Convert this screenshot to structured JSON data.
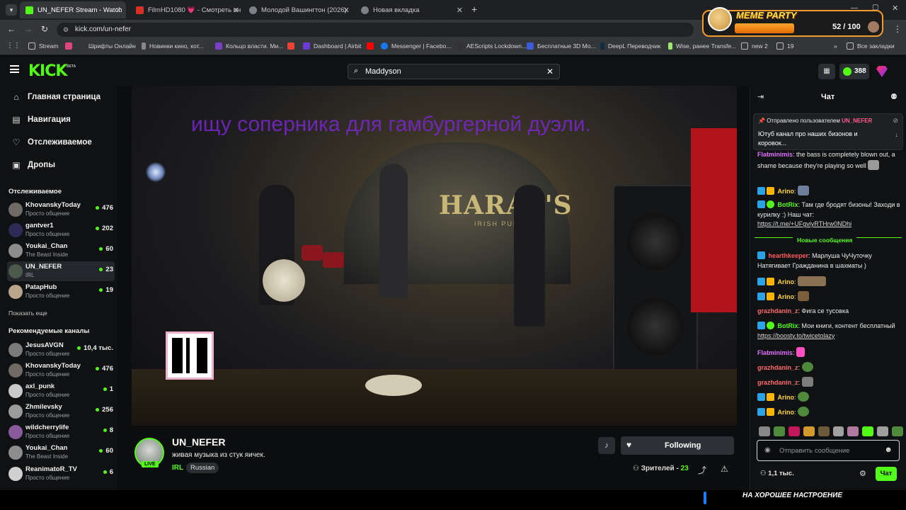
{
  "browser": {
    "tabs": [
      {
        "title": "UN_NEFER Stream - Watch",
        "active": true,
        "color": "#53fc18"
      },
      {
        "title": "FilmHD1080 💗 - Смотреть он",
        "active": false,
        "color": "#d93025"
      },
      {
        "title": "Молодой Вашингтон (2026)",
        "active": false,
        "color": "#9aa0a6"
      },
      {
        "title": "Новая вкладка",
        "active": false,
        "color": "#9aa0a6"
      }
    ],
    "url": "kick.com/un-nefer",
    "bookmarks": [
      "Stream",
      "Шрифты Онлайн",
      "Новинки кино, кот...",
      "Кольцо власти. Ми...",
      "Dashboard | Airbit",
      "Messenger | Facebo...",
      "AEScripts Lockdown...",
      "Бесплатные 3D Мо...",
      "DeepL Переводчик",
      "Wise, ранее Transfe...",
      "new 2",
      "19"
    ],
    "all_bookmarks": "Все закладки"
  },
  "extension": {
    "title": "MEME PARTY",
    "counter": "52 / 100"
  },
  "header": {
    "logo": "KICK",
    "beta": "BETA",
    "search_value": "Maddyson",
    "kicks_count": "388"
  },
  "nav": {
    "home": "Главная страница",
    "browse": "Навигация",
    "following": "Отслеживаемое",
    "drops": "Дропы"
  },
  "following_section": {
    "title": "Отслеживаемое",
    "channels": [
      {
        "name": "KhovanskyToday",
        "category": "Просто общение",
        "viewers": "476"
      },
      {
        "name": "gantver1",
        "category": "Просто общение",
        "viewers": "202"
      },
      {
        "name": "Youkai_Chan",
        "category": "The Beast Inside",
        "viewers": "60"
      },
      {
        "name": "UN_NEFER",
        "category": "IRL",
        "viewers": "23"
      },
      {
        "name": "PatapHub",
        "category": "Просто общение",
        "viewers": "19"
      }
    ],
    "show_more": "Показать еще"
  },
  "recommended_section": {
    "title": "Рекомендуемые каналы",
    "channels": [
      {
        "name": "JesusAVGN",
        "category": "Просто общение",
        "viewers": "10,4 тыс."
      },
      {
        "name": "KhovanskyToday",
        "category": "Просто общение",
        "viewers": "476"
      },
      {
        "name": "axl_punk",
        "category": "Просто общение",
        "viewers": "1"
      },
      {
        "name": "Zhmilevsky",
        "category": "Просто общение",
        "viewers": "256"
      },
      {
        "name": "wildcherrylife",
        "category": "Просто общение",
        "viewers": "8"
      },
      {
        "name": "Youkai_Chan",
        "category": "The Beast Inside",
        "viewers": "60"
      },
      {
        "name": "ReanimatoR_TV",
        "category": "Просто общение",
        "viewers": "6"
      }
    ]
  },
  "video": {
    "overlay_text": "ищу соперника для гамбургерной дуэли.",
    "sign": "HARAT'S",
    "sign_sub": "IRISH PUB"
  },
  "stream": {
    "channel": "UN_NEFER",
    "title": "живая музыка из стук яичек.",
    "live_badge": "LIVE",
    "category": "IRL",
    "language": "Russian",
    "follow_label": "Following",
    "viewers_label": "Зрителей -",
    "viewers_count": "23"
  },
  "chat": {
    "title": "Чат",
    "pinned": {
      "label": "Отправлено пользователем",
      "user": "UN_NEFER",
      "text": "Ютуб канал про наших бизонов и коровок..."
    },
    "new_messages_divider": "Новые сообщения",
    "messages": [
      {
        "user": "Flatminimis",
        "color": "#e070ff",
        "text": "the bass is completely blown out, a shame because they're playing so well"
      },
      {
        "user": "Arino",
        "color": "#ffd43b",
        "text": ""
      },
      {
        "user": "BotRix",
        "color": "#53fc18",
        "text": "Там где бродят бизоны! Заходи в курилку :) Наш чат:",
        "link": "https://t.me/+UFgviyRTHrw0NDhi"
      },
      {
        "user": "hearthkeeper",
        "color": "#ff5c5c",
        "text": "Марлуша ЧуЧуточку Натягивает Гражданина в шахматы )"
      },
      {
        "user": "Arino",
        "color": "#ffd43b",
        "text": ""
      },
      {
        "user": "Arino",
        "color": "#ffd43b",
        "text": ""
      },
      {
        "user": "grazhdanin_z",
        "color": "#ff6b6b",
        "text": "Фига се тусовка"
      },
      {
        "user": "BotRix",
        "color": "#53fc18",
        "text": "Мои книги, контент бесплатный",
        "link": "https://boosty.to/twicetolazy"
      },
      {
        "user": "Flatminimis",
        "color": "#e070ff",
        "text": ""
      },
      {
        "user": "grazhdanin_z",
        "color": "#ff6b6b",
        "text": ""
      },
      {
        "user": "grazhdanin_z",
        "color": "#ff6b6b",
        "text": ""
      },
      {
        "user": "Arino",
        "color": "#ffd43b",
        "text": ""
      },
      {
        "user": "Arino",
        "color": "#ffd43b",
        "text": ""
      }
    ],
    "input_placeholder": "Отправить сообщение",
    "points": "1,1 тыс.",
    "send_label": "Чат"
  },
  "bottom_caption": "НА ХОРОШЕЕ НАСТРОЕНИЕ",
  "colors": {
    "accent": "#53fc18",
    "bg": "#0b0d0e",
    "panel": "#0f1113"
  }
}
